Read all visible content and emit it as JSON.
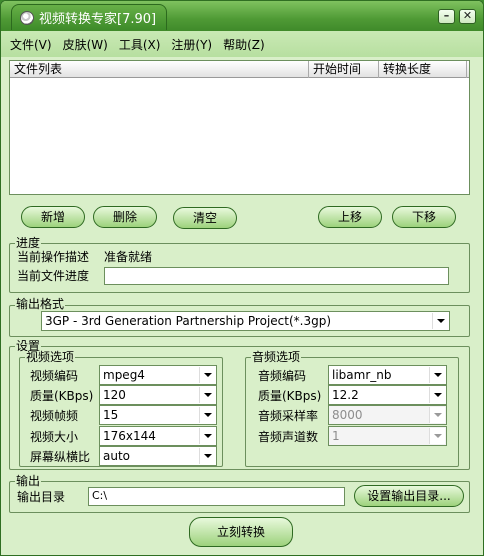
{
  "window": {
    "title": "视频转换专家[7.90]",
    "minimize_label": "–",
    "close_label": "✕"
  },
  "menu": [
    "文件(V)",
    "皮肤(W)",
    "工具(X)",
    "注册(Y)",
    "帮助(Z)"
  ],
  "file_list": {
    "columns": [
      "文件列表",
      "开始时间",
      "转换长度"
    ],
    "rows": []
  },
  "buttons": {
    "add": "新增",
    "delete": "删除",
    "clear": "清空",
    "move_up": "上移",
    "move_down": "下移",
    "set_output_dir": "设置输出目录...",
    "convert": "立刻转换"
  },
  "progress": {
    "group_label": "进度",
    "op_desc_label": "当前操作描述",
    "op_desc_value": "准备就绪",
    "file_progress_label": "当前文件进度"
  },
  "output_format": {
    "group_label": "输出格式",
    "selected": "3GP - 3rd Generation Partnership Project(*.3gp)"
  },
  "settings": {
    "group_label": "设置",
    "video": {
      "group_label": "视频选项",
      "codec_label": "视频编码",
      "codec_value": "mpeg4",
      "quality_label": "质量(KBps)",
      "quality_value": "120",
      "framerate_label": "视频帧频",
      "framerate_value": "15",
      "size_label": "视频大小",
      "size_value": "176x144",
      "aspect_label": "屏幕纵横比",
      "aspect_value": "auto"
    },
    "audio": {
      "group_label": "音频选项",
      "codec_label": "音频编码",
      "codec_value": "libamr_nb",
      "quality_label": "质量(KBps)",
      "quality_value": "12.2",
      "samplerate_label": "音频采样率",
      "samplerate_value": "8000",
      "channels_label": "音频声道数",
      "channels_value": "1"
    }
  },
  "output": {
    "group_label": "输出",
    "dir_label": "输出目录",
    "dir_value": "C:\\"
  },
  "colors": {
    "window_bg": "#d9efc9",
    "titlebar": "#4f9a35",
    "border": "#2f6e22"
  }
}
